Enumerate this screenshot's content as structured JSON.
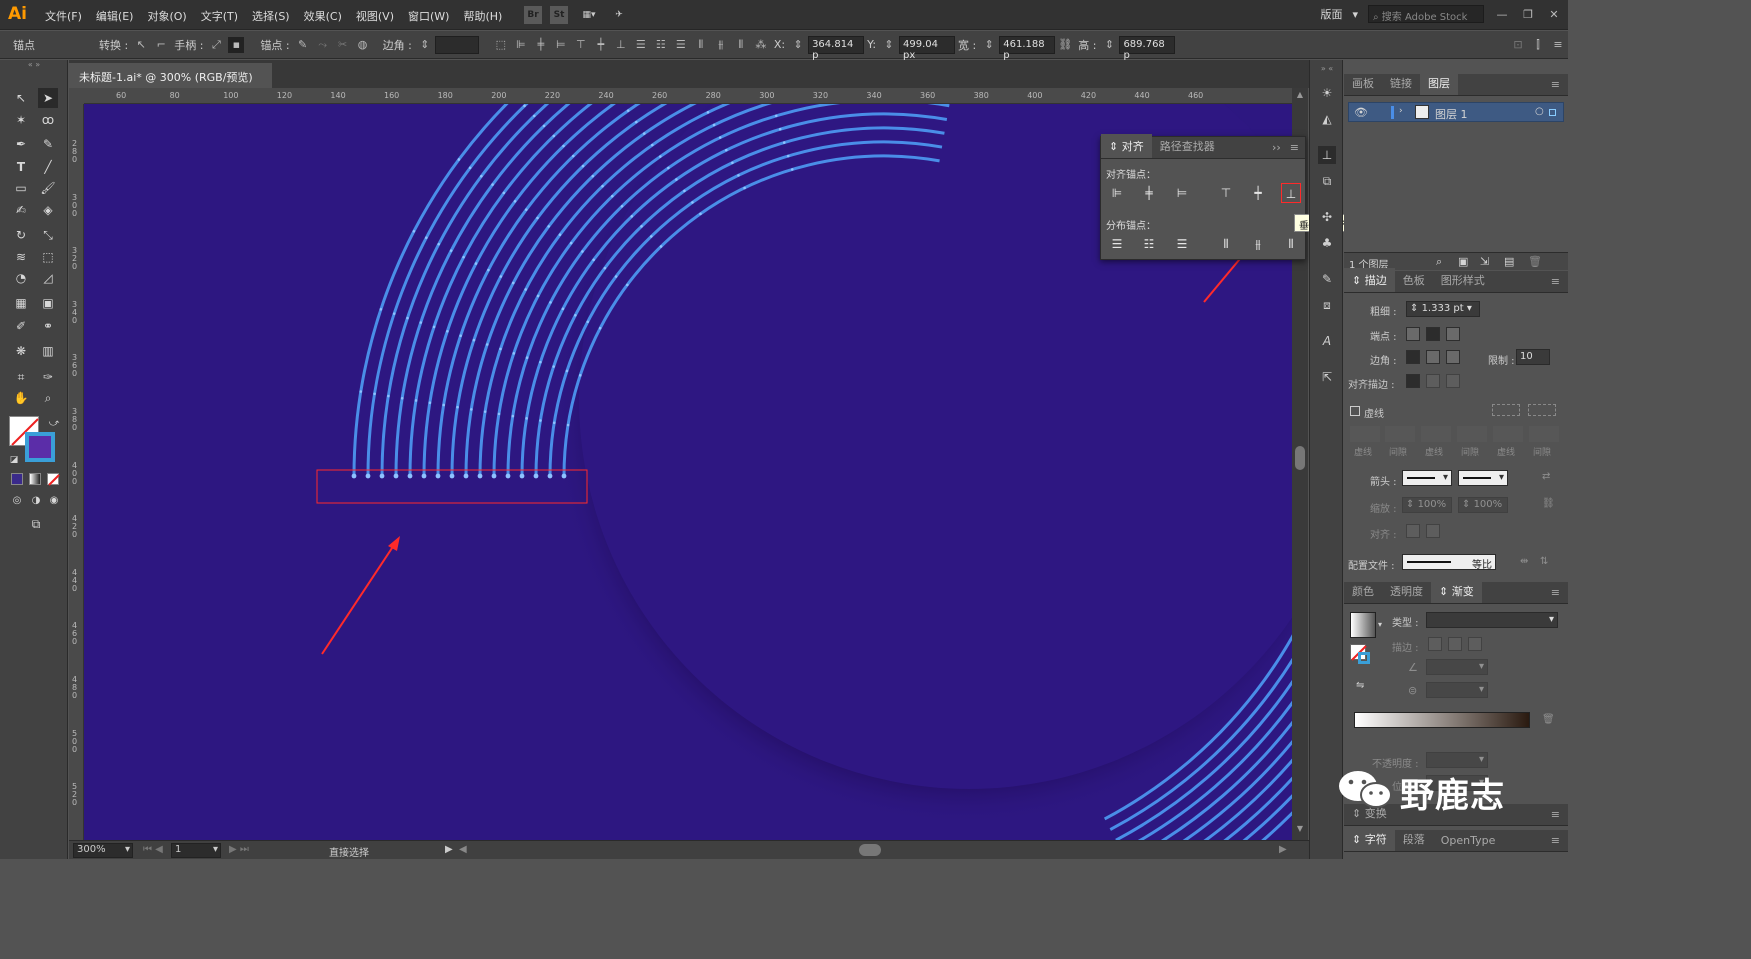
{
  "app": {
    "logo": "Ai",
    "workspace": "版面",
    "search_placeholder": "搜索 Adobe Stock",
    "win_min": "—",
    "win_max": "❐",
    "win_close": "✕",
    "menus": [
      "文件(F)",
      "编辑(E)",
      "对象(O)",
      "文字(T)",
      "选择(S)",
      "效果(C)",
      "视图(V)",
      "窗口(W)",
      "帮助(H)"
    ],
    "bridge_icon": "Br",
    "stock_icon": "St"
  },
  "control": {
    "anchor": "锚点",
    "convert": "转换 :",
    "handles": "手柄 :",
    "anchors": "锚点 :",
    "corner": "边角 :",
    "x_label": "X:",
    "x_value": "364.814 p",
    "y_label": "Y:",
    "y_value": "499.04 px",
    "w_label": "宽 :",
    "w_value": "461.188 p",
    "h_label": "高 :",
    "h_value": "689.768 p"
  },
  "document": {
    "tab_title": "未标题-1.ai* @ 300% (RGB/预览)",
    "tab_close": "✕"
  },
  "rulers": {
    "h": [
      "60",
      "80",
      "100",
      "120",
      "140",
      "160",
      "180",
      "200",
      "220",
      "240",
      "260",
      "280",
      "300",
      "320",
      "340",
      "360",
      "380",
      "400",
      "420",
      "440",
      "460"
    ],
    "v": [
      "2\n8\n0",
      "3\n0\n0",
      "3\n2\n0",
      "3\n4\n0",
      "3\n6\n0",
      "3\n8\n0",
      "4\n0\n0",
      "4\n2\n0",
      "4\n4\n0",
      "4\n6\n0",
      "4\n8\n0",
      "5\n0\n0",
      "5\n2\n0"
    ]
  },
  "status": {
    "zoom": "300%",
    "page": "1",
    "tool": "直接选择"
  },
  "align_panel": {
    "tab1": "对齐",
    "tab2": "路径查找器",
    "sec_align": "对齐锚点：",
    "sec_dist": "分布锚点：",
    "tooltip": "垂直底对齐"
  },
  "layers": {
    "tabs": [
      "画板",
      "链接",
      "图层"
    ],
    "layer_name": "图层 1",
    "count": "1 个图层"
  },
  "stroke": {
    "tabs": [
      "描边",
      "色板",
      "图形样式"
    ],
    "weight_label": "粗细 :",
    "weight_value": "1.333 pt",
    "cap_label": "端点 :",
    "corner_label": "边角 :",
    "limit_label": "限制 :",
    "limit_value": "10",
    "align_label": "对齐描边 :",
    "dashed_label": "虚线",
    "dash_labels": [
      "虚线",
      "间隙",
      "虚线",
      "间隙",
      "虚线",
      "间隙"
    ],
    "arrow_label": "箭头 :",
    "scale_label": "缩放 :",
    "scale1": "100%",
    "scale2": "100%",
    "arrow_align_label": "对齐 :",
    "profile_label": "配置文件 :",
    "profile_value": "等比"
  },
  "gradient": {
    "tabs": [
      "颜色",
      "透明度",
      "渐变"
    ],
    "type_label": "类型 :",
    "stroke_label": "描边 :",
    "opacity_label": "不透明度 :",
    "location_label": "位置 :"
  },
  "bottom": {
    "transform": "变换",
    "tabs": [
      "字符",
      "段落",
      "OpenType"
    ]
  },
  "watermark": {
    "text": "野鹿志"
  },
  "colors": {
    "canvas": "#2d1781",
    "lines": "#4a8ee8",
    "dots": "#8fc2ff",
    "highlight": "#ff2a2a"
  }
}
